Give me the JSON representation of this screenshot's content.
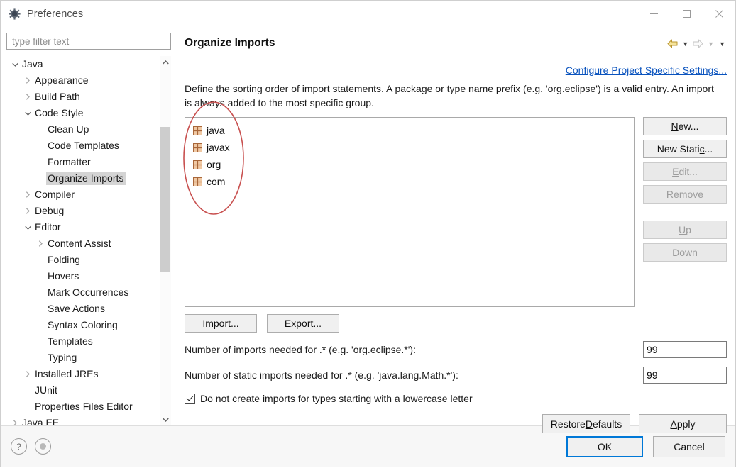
{
  "window": {
    "title": "Preferences",
    "icon": "gear-icon",
    "minimize": "–",
    "maximize": "□",
    "close": "✕"
  },
  "sidebar": {
    "filter": {
      "value": "",
      "placeholder": "type filter text"
    },
    "items": [
      {
        "label": "Java",
        "level": 0,
        "twisty": "expanded",
        "selected": false
      },
      {
        "label": "Appearance",
        "level": 1,
        "twisty": "collapsed",
        "selected": false
      },
      {
        "label": "Build Path",
        "level": 1,
        "twisty": "collapsed",
        "selected": false
      },
      {
        "label": "Code Style",
        "level": 1,
        "twisty": "expanded",
        "selected": false
      },
      {
        "label": "Clean Up",
        "level": 2,
        "twisty": "none",
        "selected": false
      },
      {
        "label": "Code Templates",
        "level": 2,
        "twisty": "none",
        "selected": false
      },
      {
        "label": "Formatter",
        "level": 2,
        "twisty": "none",
        "selected": false
      },
      {
        "label": "Organize Imports",
        "level": 2,
        "twisty": "none",
        "selected": true
      },
      {
        "label": "Compiler",
        "level": 1,
        "twisty": "collapsed",
        "selected": false
      },
      {
        "label": "Debug",
        "level": 1,
        "twisty": "collapsed",
        "selected": false
      },
      {
        "label": "Editor",
        "level": 1,
        "twisty": "expanded",
        "selected": false
      },
      {
        "label": "Content Assist",
        "level": 2,
        "twisty": "collapsed",
        "selected": false
      },
      {
        "label": "Folding",
        "level": 2,
        "twisty": "none",
        "selected": false
      },
      {
        "label": "Hovers",
        "level": 2,
        "twisty": "none",
        "selected": false
      },
      {
        "label": "Mark Occurrences",
        "level": 2,
        "twisty": "none",
        "selected": false
      },
      {
        "label": "Save Actions",
        "level": 2,
        "twisty": "none",
        "selected": false
      },
      {
        "label": "Syntax Coloring",
        "level": 2,
        "twisty": "none",
        "selected": false
      },
      {
        "label": "Templates",
        "level": 2,
        "twisty": "none",
        "selected": false
      },
      {
        "label": "Typing",
        "level": 2,
        "twisty": "none",
        "selected": false
      },
      {
        "label": "Installed JREs",
        "level": 1,
        "twisty": "collapsed",
        "selected": false
      },
      {
        "label": "JUnit",
        "level": 1,
        "twisty": "none",
        "selected": false
      },
      {
        "label": "Properties Files Editor",
        "level": 1,
        "twisty": "none",
        "selected": false
      },
      {
        "label": "Java EE",
        "level": 0,
        "twisty": "collapsed",
        "selected": false
      }
    ]
  },
  "page": {
    "title": "Organize Imports",
    "nav": {
      "back_icon": "back-arrow-icon",
      "back_menu_icon": "chevron-down-icon",
      "forward_icon": "forward-arrow-icon",
      "forward_menu_icon": "chevron-down-icon",
      "overflow_icon": "chevron-down-icon"
    },
    "project_settings_link": "Configure Project Specific Settings...",
    "description": "Define the sorting order of import statements. A package or type name prefix (e.g. 'org.eclipse') is a valid entry. An import is always added to the most specific group.",
    "import_order": [
      {
        "name": "java",
        "icon": "package-icon"
      },
      {
        "name": "javax",
        "icon": "package-icon"
      },
      {
        "name": "org",
        "icon": "package-icon"
      },
      {
        "name": "com",
        "icon": "package-icon"
      }
    ],
    "side_buttons": [
      {
        "label": "New...",
        "mnemonic": "N",
        "enabled": true
      },
      {
        "label": "New Static...",
        "mnemonic": "c",
        "enabled": true
      },
      {
        "label": "Edit...",
        "mnemonic": "E",
        "enabled": false
      },
      {
        "label": "Remove",
        "mnemonic": "R",
        "enabled": false
      },
      {
        "label": "Up",
        "mnemonic": "U",
        "enabled": false
      },
      {
        "label": "Down",
        "mnemonic": "w",
        "enabled": false
      }
    ],
    "io_buttons": [
      {
        "label": "Import...",
        "mnemonic": "m",
        "enabled": true
      },
      {
        "label": "Export...",
        "mnemonic": "x",
        "enabled": true
      }
    ],
    "settings": [
      {
        "label": "Number of imports needed for .* (e.g. 'org.eclipse.*'):",
        "mnemonic": "i",
        "value": "99"
      },
      {
        "label": "Number of static imports needed for .* (e.g. 'java.lang.Math.*'):",
        "mnemonic": "s",
        "value": "99"
      }
    ],
    "checkbox": {
      "label": "Do not create imports for types starting with a lowercase letter",
      "mnemonic": "t",
      "checked": true
    },
    "page_buttons": [
      {
        "label": "Restore Defaults",
        "mnemonic": "D",
        "enabled": true
      },
      {
        "label": "Apply",
        "mnemonic": "A",
        "enabled": true
      }
    ]
  },
  "footer": {
    "help_icon": "?",
    "second_icon": "record-icon",
    "ok": "OK",
    "cancel": "Cancel"
  },
  "annotation": {
    "type": "ellipse",
    "color": "#c8504f",
    "target": "import-order-list"
  }
}
